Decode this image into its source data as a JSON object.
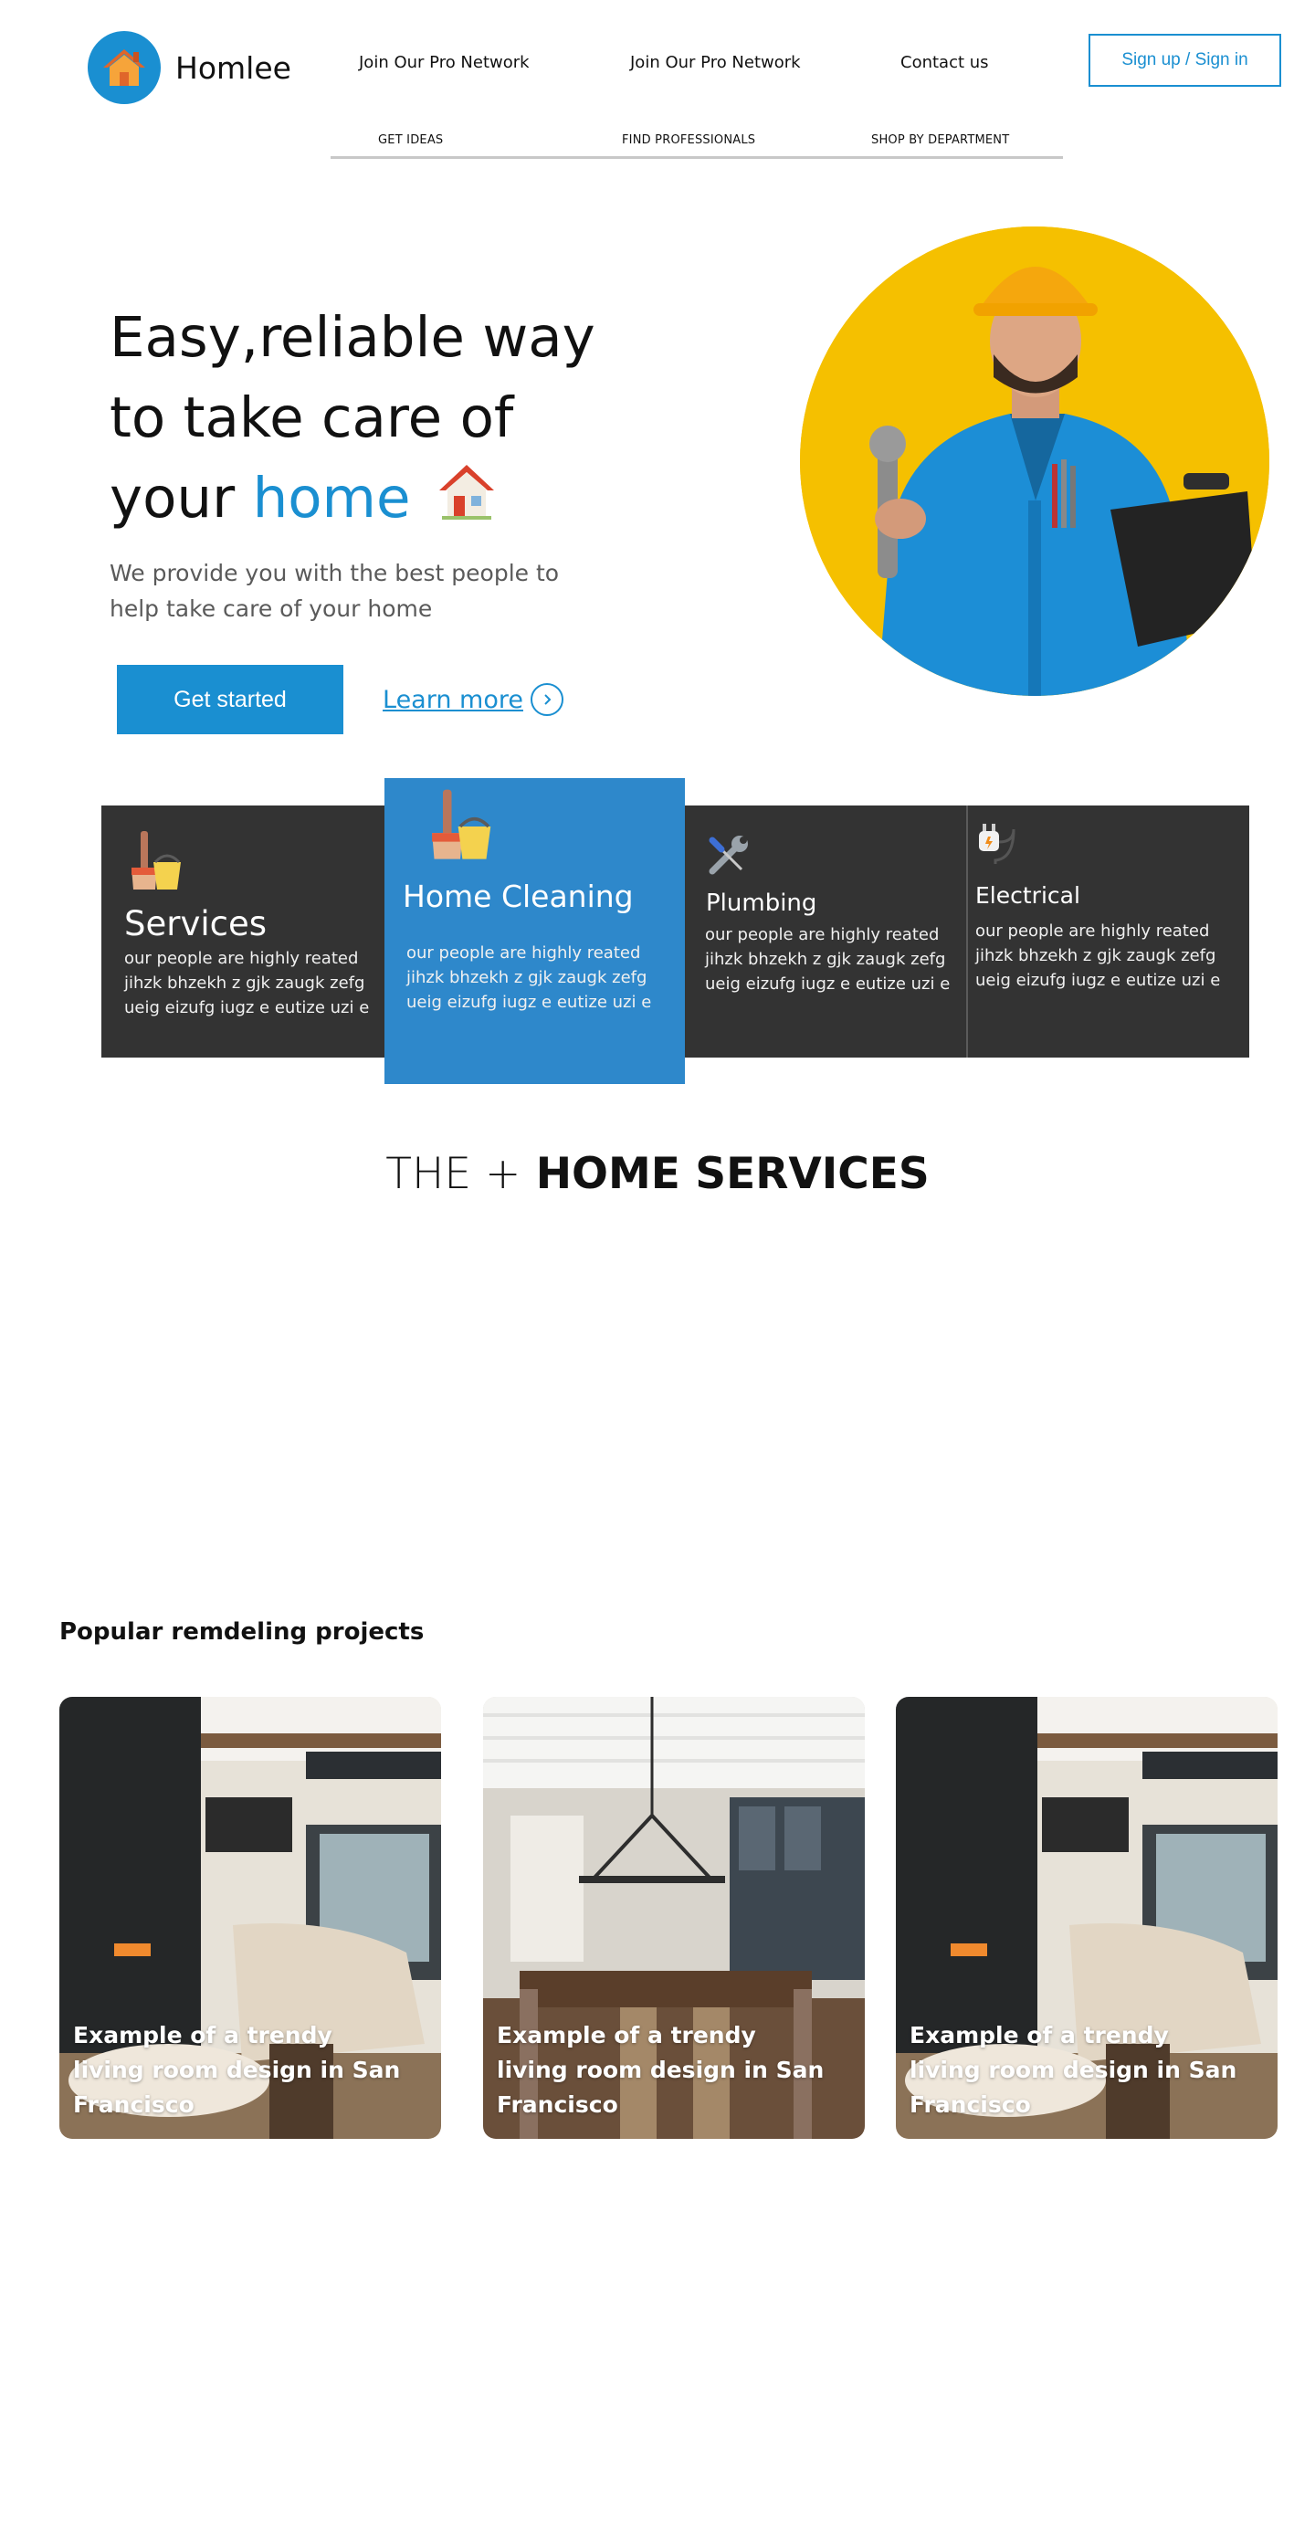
{
  "brand": {
    "name": "Homlee",
    "accent_color": "#1a8fd1",
    "icon": "house-icon"
  },
  "topnav": {
    "items": [
      "Join Our Pro Network",
      "Join Our Pro Network",
      "Contact us"
    ],
    "signin_label": "Sign up / Sign in"
  },
  "subnav": {
    "items": [
      "GET IDEAS",
      "FIND PROFESSIONALS",
      "SHOP BY DEPARTMENT"
    ]
  },
  "hero": {
    "title_line1": "Easy,reliable way",
    "title_line2": "to take care of",
    "title_line3_prefix": "your",
    "title_line3_accent": "home",
    "house_icon": "house-emoji-icon",
    "subtitle": "We provide you with the best people to help take care of your home",
    "cta_primary": "Get started",
    "cta_secondary": "Learn more",
    "photo": "worker-photo"
  },
  "services": [
    {
      "title": "Services",
      "icon": "broom-bucket-icon",
      "text": "our people are highly reated jihzk bhzekh z gjk zaugk zefg ueig eizufg iugz e  eutize uzi e"
    },
    {
      "title": "Home Cleaning",
      "icon": "broom-bucket-icon",
      "text": "our people are highly reated jihzk bhzekh z gjk zaugk zefg ueig eizufg iugz e  eutize uzi e"
    },
    {
      "title": "Plumbing",
      "icon": "wrench-screwdriver-icon",
      "text": "our people are highly reated jihzk bhzekh z gjk zaugk zefg ueig eizufg iugz e  eutize uzi e"
    },
    {
      "title": "Electrical",
      "icon": "plug-icon",
      "text": "our people are highly reated jihzk bhzekh z gjk zaugk zefg ueig eizufg iugz e  eutize uzi e"
    }
  ],
  "section": {
    "title_thin": "THE +",
    "title_bold": "HOME SERVICES"
  },
  "popular": {
    "heading": "Popular remdeling projects",
    "projects": [
      {
        "caption": "Example of a trendy living room design in San Francisco",
        "image": "living-room-photo"
      },
      {
        "caption": "Example of a trendy living room design in San Francisco",
        "image": "dining-room-photo"
      },
      {
        "caption": "Example of a trendy living room design in San Francisco",
        "image": "living-room-photo"
      }
    ]
  }
}
